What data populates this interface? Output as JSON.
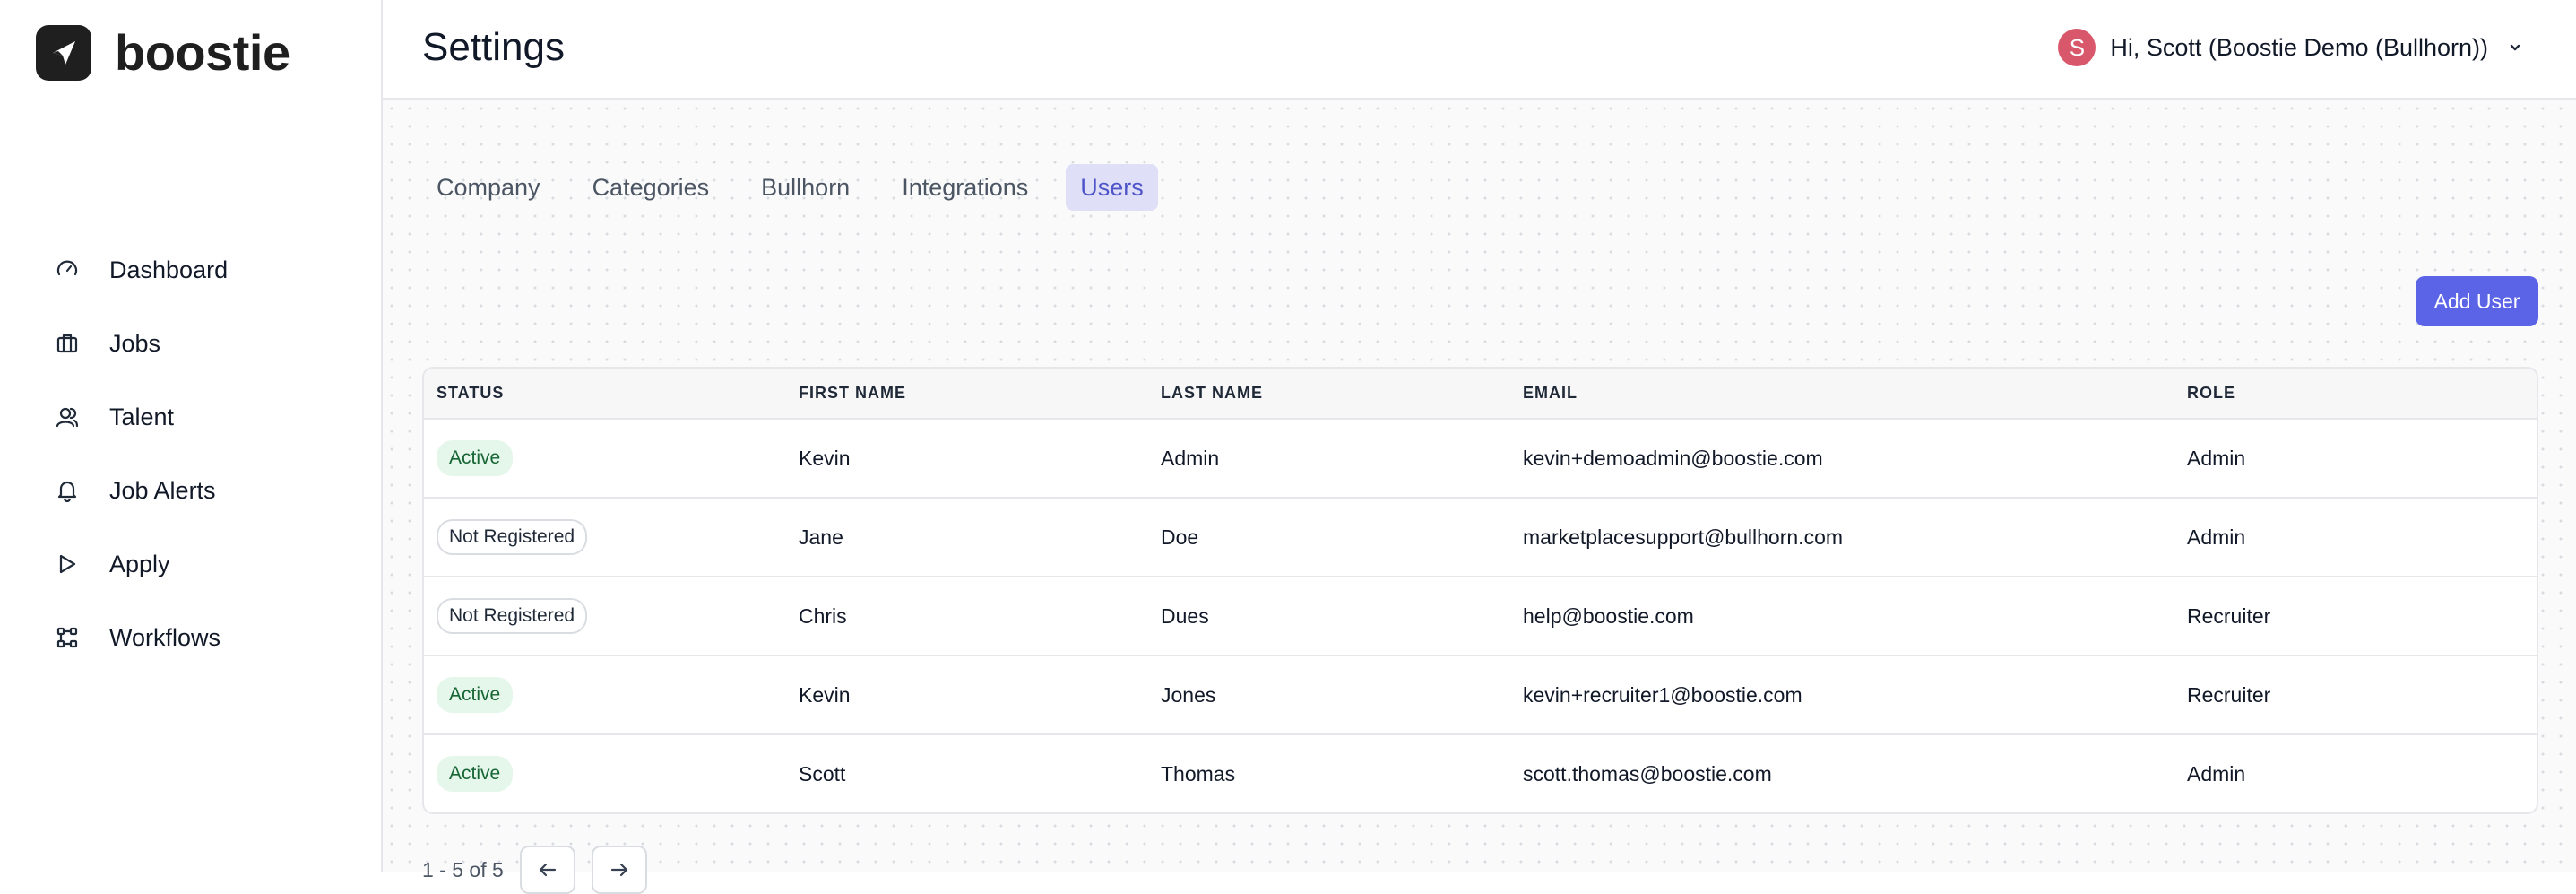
{
  "brand": {
    "name": "boostie",
    "icon": "boostie-logo-icon"
  },
  "nav": [
    {
      "label": "Dashboard",
      "icon": "dashboard-gauge-icon"
    },
    {
      "label": "Jobs",
      "icon": "briefcase-icon"
    },
    {
      "label": "Talent",
      "icon": "users-icon"
    },
    {
      "label": "Job Alerts",
      "icon": "bell-icon"
    },
    {
      "label": "Apply",
      "icon": "play-arrow-icon"
    },
    {
      "label": "Workflows",
      "icon": "workflow-nodes-icon"
    }
  ],
  "header": {
    "title": "Settings",
    "user": {
      "avatar_initial": "S",
      "greeting": "Hi, Scott (Boostie Demo (Bullhorn))"
    }
  },
  "tabs": [
    {
      "label": "Company",
      "active": false
    },
    {
      "label": "Categories",
      "active": false
    },
    {
      "label": "Bullhorn",
      "active": false
    },
    {
      "label": "Integrations",
      "active": false
    },
    {
      "label": "Users",
      "active": true
    }
  ],
  "add_user_label": "Add User",
  "table": {
    "headers": [
      "STATUS",
      "FIRST NAME",
      "LAST NAME",
      "EMAIL",
      "ROLE"
    ],
    "rows": [
      {
        "status": "Active",
        "first": "Kevin",
        "last": "Admin",
        "email": "kevin+demoadmin@boostie.com",
        "role": "Admin"
      },
      {
        "status": "Not Registered",
        "first": "Jane",
        "last": "Doe",
        "email": "marketplacesupport@bullhorn.com",
        "role": "Admin"
      },
      {
        "status": "Not Registered",
        "first": "Chris",
        "last": "Dues",
        "email": "help@boostie.com",
        "role": "Recruiter"
      },
      {
        "status": "Active",
        "first": "Kevin",
        "last": "Jones",
        "email": "kevin+recruiter1@boostie.com",
        "role": "Recruiter"
      },
      {
        "status": "Active",
        "first": "Scott",
        "last": "Thomas",
        "email": "scott.thomas@boostie.com",
        "role": "Admin"
      }
    ]
  },
  "pagination": {
    "text": "1 - 5 of 5"
  },
  "colors": {
    "accent": "#5b63e6",
    "active_tab_bg": "#dfe0f8",
    "active_badge_bg": "#e5f6ea",
    "avatar": "#d9576b"
  }
}
